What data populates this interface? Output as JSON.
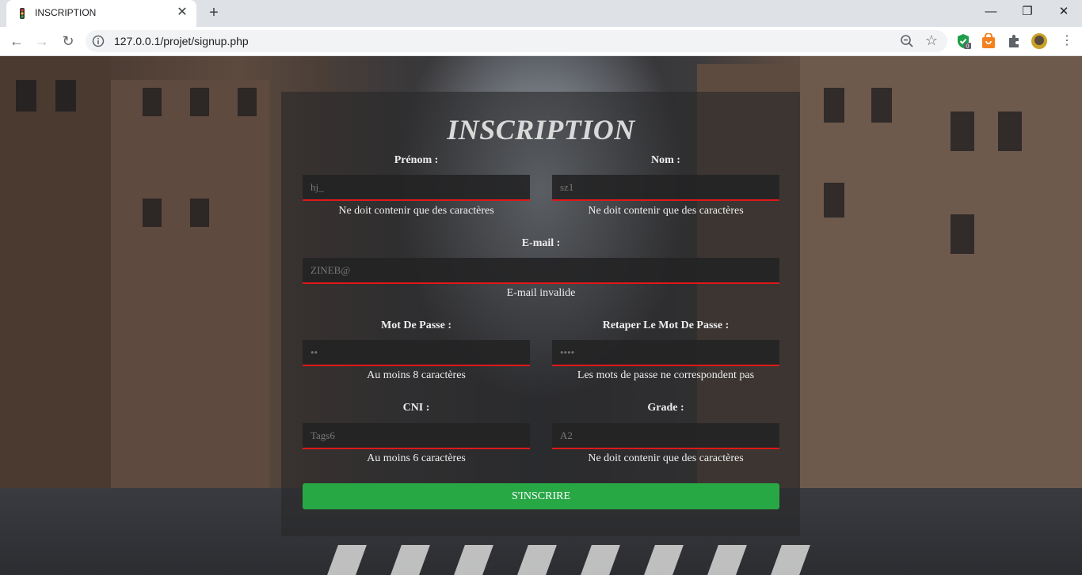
{
  "browser": {
    "tab_title": "INSCRIPTION",
    "url": "127.0.0.1/projet/signup.php",
    "extension_badge": "0"
  },
  "form": {
    "title": "INSCRIPTION",
    "fields": {
      "prenom": {
        "label": "Prénom :",
        "value": "hj_",
        "error": "Ne doit contenir que des caractères"
      },
      "nom": {
        "label": "Nom :",
        "value": "sz1",
        "error": "Ne doit contenir que des caractères"
      },
      "email": {
        "label": "E-mail :",
        "value": "ZINEB@",
        "error": "E-mail invalide"
      },
      "password": {
        "label": "Mot De Passe :",
        "value": "••",
        "error": "Au moins 8 caractères"
      },
      "password_confirm": {
        "label": "Retaper Le Mot De Passe :",
        "value": "••••",
        "error": "Les mots de passe ne correspondent pas"
      },
      "cni": {
        "label": "CNI :",
        "value": "Tags6",
        "error": "Au moins 6 caractères"
      },
      "grade": {
        "label": "Grade :",
        "value": "A2",
        "error": "Ne doit contenir que des caractères"
      }
    },
    "submit_label": "S'INSCRIRE"
  },
  "colors": {
    "error_border": "#e01818",
    "submit_bg": "#28a745"
  }
}
